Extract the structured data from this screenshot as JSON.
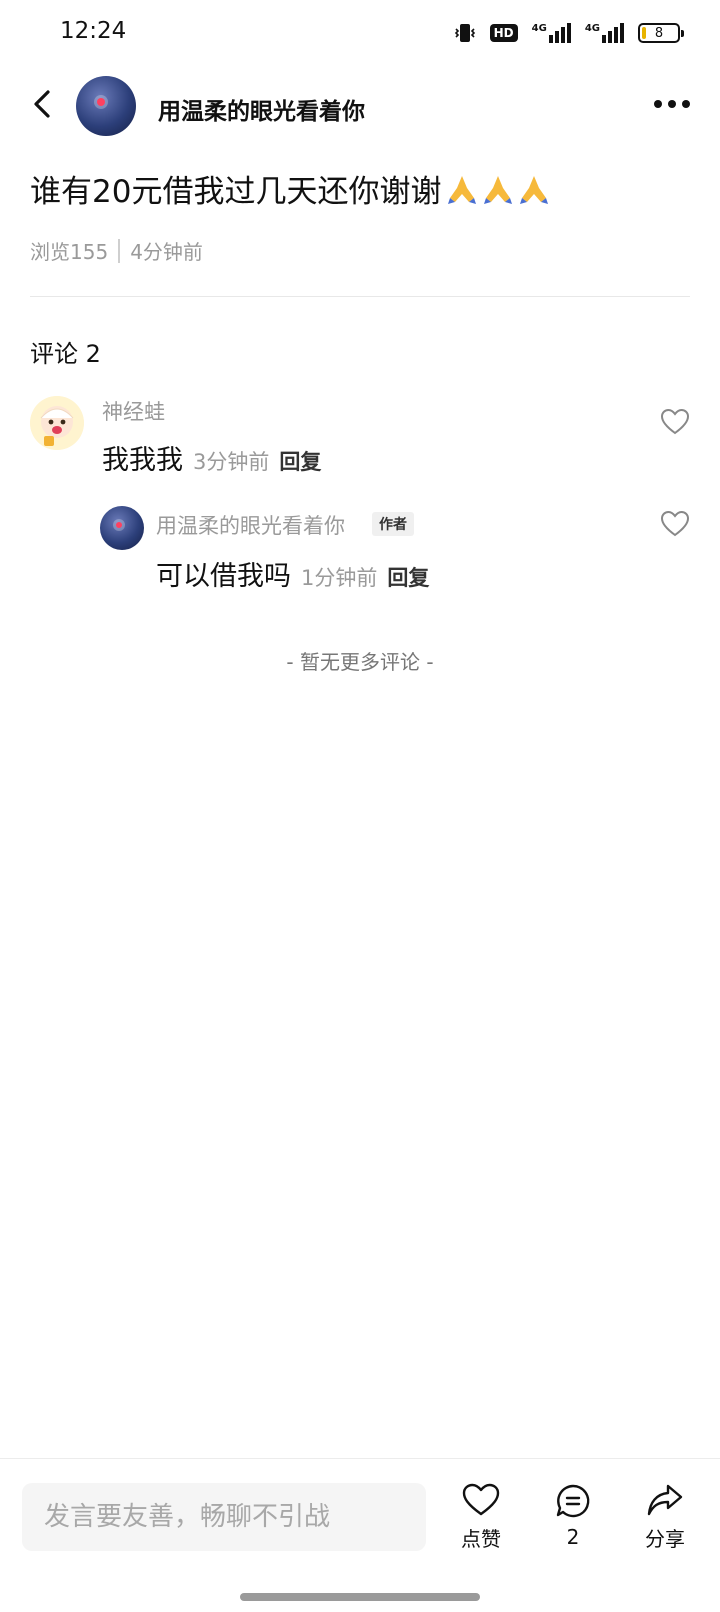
{
  "status_bar": {
    "time": "12:24",
    "hd_label": "HD",
    "net1_label": "4G",
    "net2_label": "4G",
    "battery_level": "8",
    "icons": [
      "vibrate-icon",
      "hd-voice-icon",
      "signal-4g-icon",
      "signal-4g-icon",
      "battery-icon"
    ]
  },
  "header": {
    "back_icon": "chevron-left-icon",
    "author_name": "用温柔的眼光看着你",
    "more_icon": "more-dots-icon"
  },
  "post": {
    "title": "谁有20元借我过几天还你谢谢",
    "title_emoji": "folded-hands-emoji x3",
    "views": "浏览155",
    "time": "4分钟前"
  },
  "comments": {
    "header": "评论 2",
    "items": [
      {
        "name": "神经蛙",
        "text": "我我我",
        "time": "3分钟前",
        "reply_label": "回复",
        "is_author": false
      },
      {
        "name": "用温柔的眼光看着你",
        "badge": "作者",
        "text": "可以借我吗",
        "time": "1分钟前",
        "reply_label": "回复",
        "is_author": true
      }
    ],
    "end_text": "- 暂无更多评论 -"
  },
  "bottom_bar": {
    "input_placeholder": "发言要友善，畅聊不引战",
    "like_label": "点赞",
    "comment_count": "2",
    "share_label": "分享"
  },
  "colors": {
    "text_primary": "#111111",
    "text_secondary": "#9a9a9a",
    "input_bg": "#f5f5f5",
    "divider": "#e8e8e8"
  }
}
